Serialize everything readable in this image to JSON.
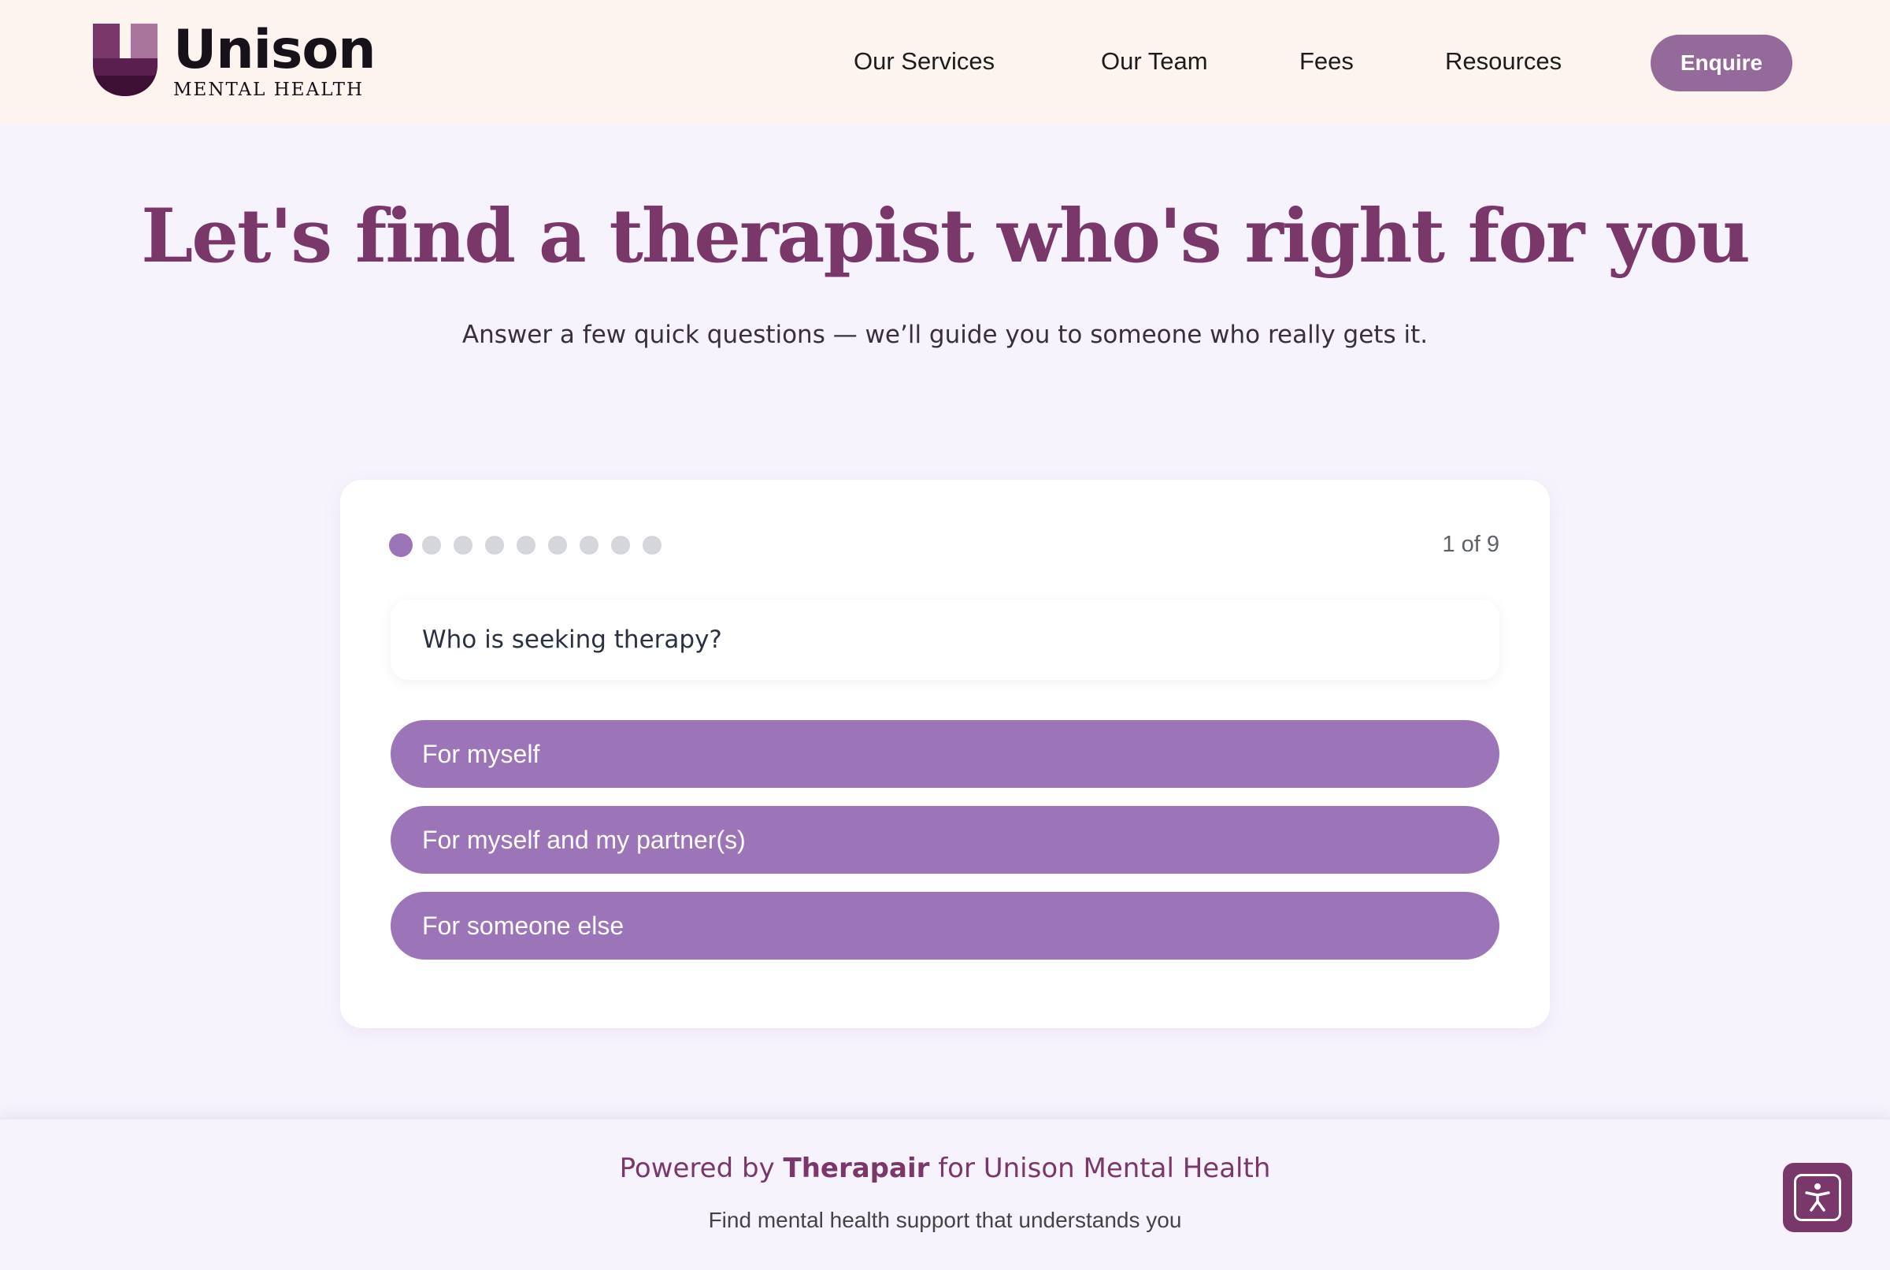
{
  "brand": {
    "name": "Unison",
    "subtitle": "MENTAL HEALTH",
    "colors": {
      "primary": "#7a386a",
      "accent": "#9c74b8",
      "button": "#936a99",
      "header_bg": "#fdf3ef",
      "page_bg": "#f7f3fd"
    }
  },
  "nav": {
    "items": [
      {
        "label": "Our Services"
      },
      {
        "label": "Our Team"
      },
      {
        "label": "Fees"
      },
      {
        "label": "Resources"
      }
    ],
    "cta_label": "Enquire"
  },
  "hero": {
    "title": "Let's find a therapist who's right for you",
    "subtitle": "Answer a few quick questions — we’ll guide you to someone who really gets it."
  },
  "quiz": {
    "current_step": 1,
    "total_steps": 9,
    "step_label": "1 of 9",
    "question": "Who is seeking therapy?",
    "options": [
      {
        "label": "For myself"
      },
      {
        "label": "For myself and my partner(s)"
      },
      {
        "label": "For someone else"
      }
    ]
  },
  "footer": {
    "powered_prefix": "Powered by",
    "powered_brand": "Therapair",
    "powered_suffix": "for Unison Mental Health",
    "tagline": "Find mental health support that understands you",
    "accessibility_icon": "accessibility-icon"
  }
}
